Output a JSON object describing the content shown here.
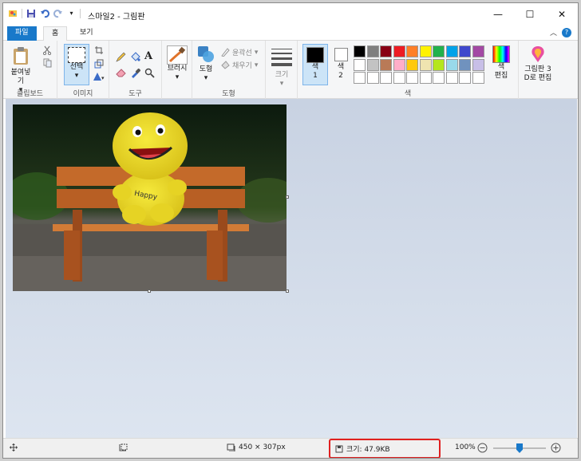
{
  "window": {
    "title": "스마일2 - 그림판",
    "minimize": "—",
    "maximize": "☐",
    "close": "✕"
  },
  "tabs": {
    "file": "파일",
    "home": "홈",
    "view": "보기"
  },
  "ribbon": {
    "clipboard": {
      "paste": "붙여넣기",
      "group": "클립보드"
    },
    "image": {
      "select": "선택",
      "group": "이미지"
    },
    "tools": {
      "group": "도구"
    },
    "brushes": {
      "label": "브러시"
    },
    "shapes": {
      "shapes": "도형",
      "outline": "윤곽선",
      "fill": "채우기",
      "group": "도형"
    },
    "size": {
      "label": "크기"
    },
    "color1": {
      "label": "색\n1"
    },
    "color2": {
      "label": "색\n2"
    },
    "colors_group": "색",
    "edit_colors": "색\n편집",
    "paint3d": "그림판 3\nD로 편집",
    "palette": [
      "#000000",
      "#7f7f7f",
      "#880015",
      "#ed1c24",
      "#ff7f27",
      "#fff200",
      "#22b14c",
      "#00a2e8",
      "#3f48cc",
      "#a349a4",
      "#ffffff",
      "#c3c3c3",
      "#b97a57",
      "#ffaec9",
      "#ffc90e",
      "#efe4b0",
      "#b5e61d",
      "#99d9ea",
      "#7092be",
      "#c8bfe7"
    ],
    "color1_value": "#000000",
    "color2_value": "#ffffff"
  },
  "status": {
    "image_size": "450 × 307px",
    "file_size": "크기: 47.9KB",
    "zoom": "100%",
    "zoom_level": 0.5
  }
}
